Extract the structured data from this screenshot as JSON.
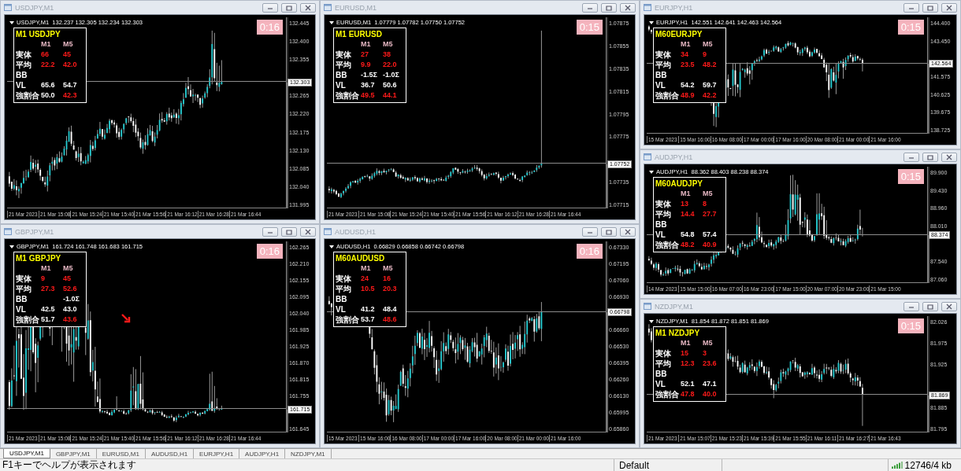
{
  "windows": [
    {
      "title": "USDJPY,M1",
      "header": "USDJPY,M1  132.237 132.305 132.234 132.303",
      "timer": "0:16",
      "panel": {
        "title": "M1 USDJPY",
        "columns": [
          "M1",
          "M5"
        ],
        "rows": [
          {
            "label": "実体",
            "values": {
              "m1": {
                "text": "66",
                "alert": true
              },
              "m5": {
                "text": "45",
                "alert": true
              }
            }
          },
          {
            "label": "平均",
            "values": {
              "m1": {
                "text": "22.2",
                "alert": true
              },
              "m5": {
                "text": "42.0",
                "alert": true
              }
            }
          },
          {
            "label": "BB"
          },
          {
            "label": "VL",
            "values": {
              "m1": {
                "text": "65.6",
                "alert": false
              },
              "m5": {
                "text": "54.7",
                "alert": false
              }
            }
          },
          {
            "label": "強割合",
            "values": {
              "m1": {
                "text": "50.0",
                "alert": false
              },
              "m5": {
                "text": "42.3",
                "alert": true
              }
            }
          }
        ]
      },
      "price_labels": [
        "132.445",
        "132.400",
        "132.355",
        "132.265",
        "132.220",
        "132.175",
        "132.130",
        "132.085",
        "132.040",
        "131.995"
      ],
      "price_tag": {
        "text": "132.303",
        "level": 0.66
      },
      "time_labels": [
        "21 Mar 2023",
        "21 Mar 15:08",
        "21 Mar 15:24",
        "21 Mar 15:40",
        "21 Mar 15:56",
        "21 Mar 16:12",
        "21 Mar 16:28",
        "21 Mar 16:44"
      ]
    },
    {
      "title": "EURUSD,M1",
      "header": "EURUSD,M1  1.07779 1.07782 1.07750 1.07752",
      "timer": "0:15",
      "panel": {
        "title": "M1 EURUSD",
        "columns": [
          "M1",
          "M5"
        ],
        "rows": [
          {
            "label": "実体",
            "values": {
              "m1": {
                "text": "27",
                "alert": true
              },
              "m5": {
                "text": "38",
                "alert": true
              }
            }
          },
          {
            "label": "平均",
            "values": {
              "m1": {
                "text": "9.9",
                "alert": true
              },
              "m5": {
                "text": "22.0",
                "alert": true
              }
            }
          },
          {
            "label": "BB",
            "values": {
              "m1": {
                "text": "-1.5Σ",
                "alert": false
              },
              "m5": {
                "text": "-1.0Σ",
                "alert": false
              }
            }
          },
          {
            "label": "VL",
            "values": {
              "m1": {
                "text": "36.7",
                "alert": false
              },
              "m5": {
                "text": "50.6",
                "alert": false
              }
            }
          },
          {
            "label": "強割合",
            "values": {
              "m1": {
                "text": "49.5",
                "alert": true
              },
              "m5": {
                "text": "44.1",
                "alert": true
              }
            }
          }
        ]
      },
      "price_labels": [
        "1.07875",
        "1.07855",
        "1.07835",
        "1.07815",
        "1.07795",
        "1.07775",
        "1.07735",
        "1.07715"
      ],
      "price_tag": {
        "text": "1.07752",
        "level": 0.23
      },
      "time_labels": [
        "21 Mar 2023",
        "21 Mar 15:08",
        "21 Mar 15:24",
        "21 Mar 15:40",
        "21 Mar 15:56",
        "21 Mar 16:12",
        "21 Mar 16:28",
        "21 Mar 16:44"
      ]
    },
    {
      "title": "EURJPY,H1",
      "header": "EURJPY,H1  142.551 142.641 142.463 142.564",
      "timer": "0:15",
      "panel": {
        "title": "M60EURJPY",
        "columns": [
          "M1",
          "M5"
        ],
        "rows": [
          {
            "label": "実体",
            "values": {
              "m1": {
                "text": "34",
                "alert": true
              },
              "m5": {
                "text": "9",
                "alert": true
              }
            }
          },
          {
            "label": "平均",
            "values": {
              "m1": {
                "text": "23.5",
                "alert": true
              },
              "m5": {
                "text": "48.2",
                "alert": true
              }
            }
          },
          {
            "label": "BB"
          },
          {
            "label": "VL",
            "values": {
              "m1": {
                "text": "54.2",
                "alert": false
              },
              "m5": {
                "text": "59.7",
                "alert": false
              }
            }
          },
          {
            "label": "強割合",
            "values": {
              "m1": {
                "text": "48.9",
                "alert": true
              },
              "m5": {
                "text": "42.2",
                "alert": true
              }
            }
          }
        ]
      },
      "price_labels": [
        "144.400",
        "143.450",
        "141.575",
        "140.625",
        "139.675",
        "138.725"
      ],
      "price_tag": {
        "text": "142.564",
        "level": 0.6
      },
      "time_labels": [
        "15 Mar 2023",
        "15 Mar 16:00",
        "16 Mar 08:00",
        "17 Mar 00:00",
        "17 Mar 16:00",
        "20 Mar 08:00",
        "21 Mar 00:00",
        "21 Mar 16:00"
      ]
    },
    {
      "title": "AUDJPY,H1",
      "header": "AUDJPY,H1  88.362 88.403 88.238 88.374",
      "timer": "0:15",
      "panel": {
        "title": "M60AUDJPY",
        "columns": [
          "M1",
          "M5"
        ],
        "rows": [
          {
            "label": "実体",
            "values": {
              "m1": {
                "text": "13",
                "alert": true
              },
              "m5": {
                "text": "8",
                "alert": true
              }
            }
          },
          {
            "label": "平均",
            "values": {
              "m1": {
                "text": "14.4",
                "alert": true
              },
              "m5": {
                "text": "27.7",
                "alert": true
              }
            }
          },
          {
            "label": "BB"
          },
          {
            "label": "VL",
            "values": {
              "m1": {
                "text": "54.8",
                "alert": false
              },
              "m5": {
                "text": "57.4",
                "alert": false
              }
            }
          },
          {
            "label": "強割合",
            "values": {
              "m1": {
                "text": "48.2",
                "alert": true
              },
              "m5": {
                "text": "40.9",
                "alert": true
              }
            }
          }
        ]
      },
      "price_labels": [
        "89.900",
        "89.430",
        "88.960",
        "88.010",
        "87.540",
        "87.060"
      ],
      "price_tag": {
        "text": "88.374",
        "level": 0.41
      },
      "time_labels": [
        "14 Mar 2023",
        "15 Mar 15:00",
        "16 Mar 07:00",
        "16 Mar 23:00",
        "17 Mar 15:00",
        "20 Mar 07:00",
        "20 Mar 23:00",
        "21 Mar 15:00"
      ]
    },
    {
      "title": "GBPJPY,M1",
      "header": "GBPJPY,M1  161.724 161.748 161.683 161.715",
      "timer": "0:16",
      "arrow": true,
      "panel": {
        "title": "M1 GBPJPY",
        "columns": [
          "M1",
          "M5"
        ],
        "rows": [
          {
            "label": "実体",
            "values": {
              "m1": {
                "text": "9",
                "alert": true
              },
              "m5": {
                "text": "45",
                "alert": true
              }
            }
          },
          {
            "label": "平均",
            "values": {
              "m1": {
                "text": "27.3",
                "alert": true
              },
              "m5": {
                "text": "52.6",
                "alert": true
              }
            }
          },
          {
            "label": "BB",
            "values": {
              "m5": {
                "text": "-1.0Σ",
                "alert": false
              }
            }
          },
          {
            "label": "VL",
            "values": {
              "m1": {
                "text": "42.5",
                "alert": false
              },
              "m5": {
                "text": "43.0",
                "alert": false
              }
            }
          },
          {
            "label": "強割合",
            "values": {
              "m1": {
                "text": "51.7",
                "alert": false
              },
              "m5": {
                "text": "43.6",
                "alert": true
              }
            }
          }
        ]
      },
      "price_labels": [
        "162.265",
        "162.210",
        "162.155",
        "162.095",
        "162.040",
        "161.985",
        "161.925",
        "161.870",
        "161.815",
        "161.755",
        "161.645"
      ],
      "price_tag": {
        "text": "161.715",
        "level": 0.12
      },
      "time_labels": [
        "21 Mar 2023",
        "21 Mar 15:08",
        "21 Mar 15:24",
        "21 Mar 15:40",
        "21 Mar 15:56",
        "21 Mar 16:12",
        "21 Mar 16:28",
        "21 Mar 16:44"
      ]
    },
    {
      "title": "AUDUSD,H1",
      "header": "AUDUSD,H1  0.66829 0.66858 0.66742 0.66798",
      "timer": "0:16",
      "panel": {
        "title": "M60AUDUSD",
        "columns": [
          "M1",
          "M5"
        ],
        "rows": [
          {
            "label": "実体",
            "values": {
              "m1": {
                "text": "24",
                "alert": true
              },
              "m5": {
                "text": "16",
                "alert": true
              }
            }
          },
          {
            "label": "平均",
            "values": {
              "m1": {
                "text": "10.5",
                "alert": true
              },
              "m5": {
                "text": "20.3",
                "alert": true
              }
            }
          },
          {
            "label": "BB"
          },
          {
            "label": "VL",
            "values": {
              "m1": {
                "text": "41.2",
                "alert": false
              },
              "m5": {
                "text": "48.4",
                "alert": false
              }
            }
          },
          {
            "label": "強割合",
            "values": {
              "m1": {
                "text": "53.7",
                "alert": false
              },
              "m5": {
                "text": "48.6",
                "alert": true
              }
            }
          }
        ]
      },
      "price_labels": [
        "0.67330",
        "0.67195",
        "0.67060",
        "0.66930",
        "0.66660",
        "0.66530",
        "0.66395",
        "0.66260",
        "0.66130",
        "0.65995",
        "0.65860"
      ],
      "price_tag": {
        "text": "0.66798",
        "level": 0.63
      },
      "time_labels": [
        "15 Mar 2023",
        "15 Mar 16:00",
        "16 Mar 08:00",
        "17 Mar 00:00",
        "17 Mar 16:00",
        "20 Mar 08:00",
        "21 Mar 00:00",
        "21 Mar 16:00"
      ]
    },
    {
      "title": "NZDJPY,M1",
      "header": "NZDJPY,M1  81.854 81.872 81.851 81.869",
      "timer": "0:15",
      "panel": {
        "title": "M1 NZDJPY",
        "columns": [
          "M1",
          "M5"
        ],
        "rows": [
          {
            "label": "実体",
            "values": {
              "m1": {
                "text": "15",
                "alert": true
              },
              "m5": {
                "text": "3",
                "alert": true
              }
            }
          },
          {
            "label": "平均",
            "values": {
              "m1": {
                "text": "12.3",
                "alert": true
              },
              "m5": {
                "text": "23.6",
                "alert": true
              }
            }
          },
          {
            "label": "BB"
          },
          {
            "label": "VL",
            "values": {
              "m1": {
                "text": "52.1",
                "alert": false
              },
              "m5": {
                "text": "47.1",
                "alert": false
              }
            }
          },
          {
            "label": "強割合",
            "values": {
              "m1": {
                "text": "47.8",
                "alert": true
              },
              "m5": {
                "text": "40.0",
                "alert": true
              }
            }
          }
        ]
      },
      "price_labels": [
        "82.026",
        "81.975",
        "81.925",
        "81.885",
        "81.795"
      ],
      "price_tag": {
        "text": "81.869",
        "level": 0.32
      },
      "time_labels": [
        "21 Mar 2023",
        "21 Mar 15:07",
        "21 Mar 15:23",
        "21 Mar 15:39",
        "21 Mar 15:55",
        "21 Mar 16:11",
        "21 Mar 16:27",
        "21 Mar 16:43"
      ]
    }
  ],
  "tabs": [
    {
      "label": "USDJPY,M1",
      "selected": true
    },
    {
      "label": "GBPJPY,M1",
      "selected": false
    },
    {
      "label": "EURUSD,M1",
      "selected": false
    },
    {
      "label": "AUDUSD,H1",
      "selected": false
    },
    {
      "label": "EURJPY,H1",
      "selected": false
    },
    {
      "label": "AUDJPY,H1",
      "selected": false
    },
    {
      "label": "NZDJPY,M1",
      "selected": false
    }
  ],
  "status_bar": {
    "help": "F1キーでヘルプが表示されます",
    "profile": "Default",
    "traffic": "12746/4 kb"
  }
}
